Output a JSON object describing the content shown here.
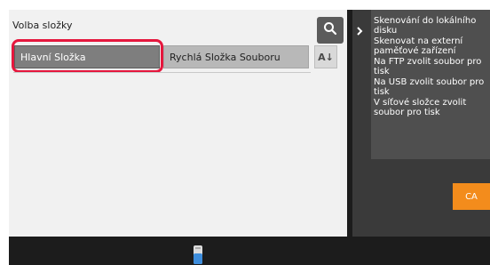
{
  "header": {
    "title": "Volba složky",
    "search_icon": "search-icon"
  },
  "tabs": [
    {
      "label": "Hlavní Složka",
      "selected": true
    },
    {
      "label": "Rychlá Složka Souboru",
      "selected": false
    }
  ],
  "sort": {
    "icon": "sort-az-icon",
    "label": "A↓"
  },
  "right_panel": {
    "collapse_icon": "chevron-right-icon",
    "actions": [
      "Skenování do lokálního disku",
      "Skenovat na externí paměťové zařízení",
      "Na FTP zvolit soubor pro tisk",
      "Na USB zvolit soubor pro tisk",
      "V síťové složce zvolit soubor pro tisk"
    ],
    "ca_label": "CA"
  },
  "footer": {
    "icon": "job-status-icon"
  },
  "colors": {
    "highlight": "#e5173d",
    "ca_button": "#f38c1c",
    "selected_tab": "#7e7e7e",
    "search_button": "#5b5b5b"
  }
}
